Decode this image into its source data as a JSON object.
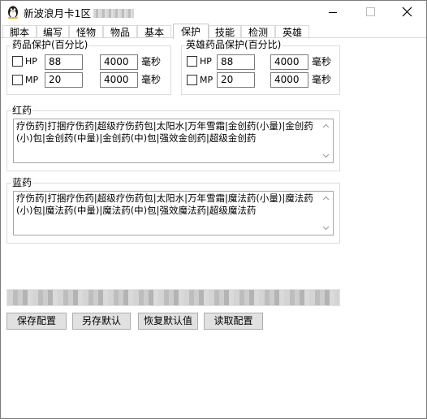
{
  "window": {
    "title": "新波浪月卡1区",
    "minimize_symbol": "—",
    "maximize_symbol": "☐",
    "close_symbol": "✕"
  },
  "tabs": [
    {
      "label": "脚本"
    },
    {
      "label": "编写"
    },
    {
      "label": "怪物"
    },
    {
      "label": "物品"
    },
    {
      "label": "基本"
    },
    {
      "label": "保护",
      "active": true
    },
    {
      "label": "技能"
    },
    {
      "label": "检测"
    },
    {
      "label": "英雄"
    }
  ],
  "drug_protect": {
    "title": "药品保护(百分比)",
    "hp": {
      "label": "HP",
      "checked": false,
      "percent": "88",
      "interval": "4000",
      "unit": "毫秒"
    },
    "mp": {
      "label": "MP",
      "checked": false,
      "percent": "20",
      "interval": "4000",
      "unit": "毫秒"
    }
  },
  "hero_protect": {
    "title": "英雄药品保护(百分比)",
    "hp": {
      "label": "HP",
      "checked": false,
      "percent": "88",
      "interval": "4000",
      "unit": "毫秒"
    },
    "mp": {
      "label": "MP",
      "checked": false,
      "percent": "20",
      "interval": "4000",
      "unit": "毫秒"
    }
  },
  "red_potion": {
    "title": "红药",
    "text": "疗伤药|打捆疗伤药|超级疗伤药包|太阳水|万年雪霜|金创药(小量)|金创药(小)包|金创药(中量)|金创药(中)包|强效金创药|超级金创药"
  },
  "blue_potion": {
    "title": "蓝药",
    "text": "疗伤药|打捆疗伤药|超级疗伤药包|太阳水|万年雪霜|魔法药(小量)|魔法药(小)包|魔法药(中量)|魔法药(中)包|强效魔法药|超级魔法药"
  },
  "buttons": {
    "save": "保存配置",
    "save_default": "另存默认",
    "restore_default": "恢复默认值",
    "load": "读取配置"
  },
  "colors": {
    "window_bg": "#ffffff",
    "button_bg": "#e1e1e1",
    "border": "#7a7a7a"
  }
}
